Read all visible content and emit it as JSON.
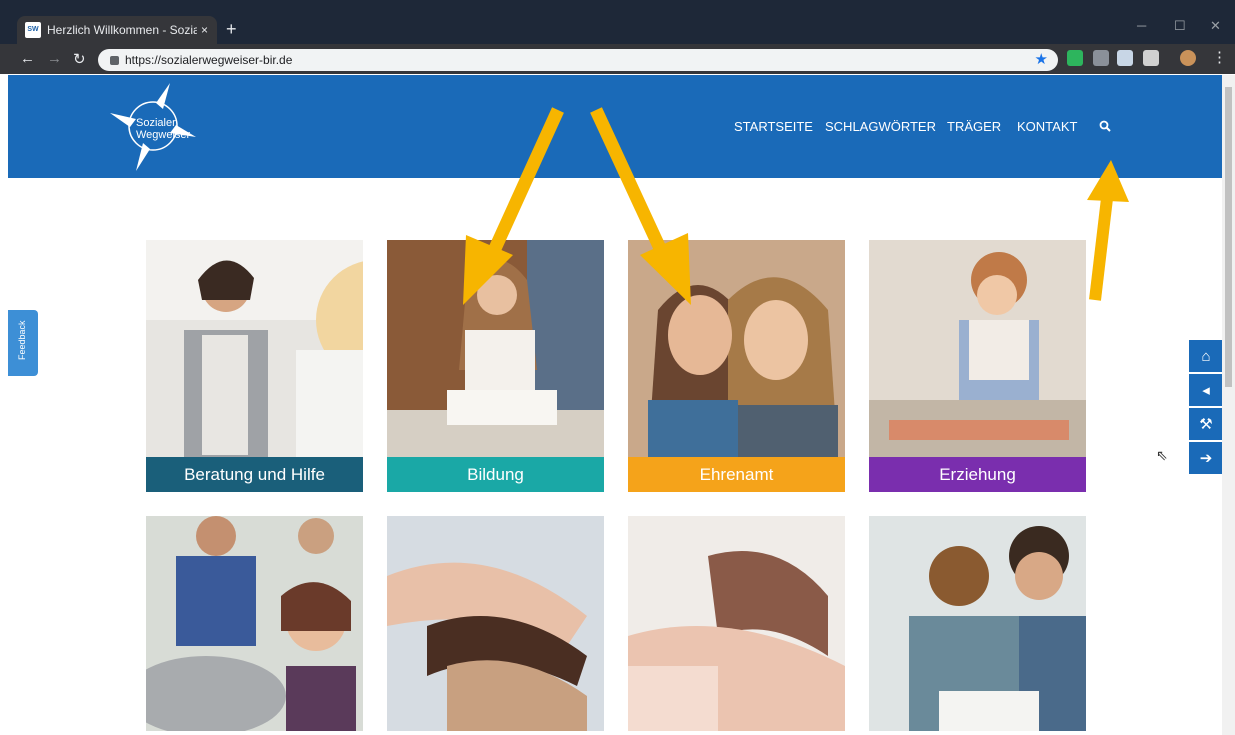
{
  "browser": {
    "tab_title": "Herzlich Willkommen - Sozialer W",
    "tab_favicon": "SW",
    "close_icon": "×",
    "new_tab_icon": "+",
    "url": "https://sozialerwegweiser-bir.de"
  },
  "site": {
    "logo_line1": "Sozialer",
    "logo_line2": "Wegweiser",
    "nav": [
      "STARTSEITE",
      "SCHLAGWÖRTER",
      "TRÄGER",
      "KONTAKT"
    ],
    "feedback": "Feedback"
  },
  "tiles": [
    {
      "label": "Beratung und Hilfe",
      "color": "#1a5f7a"
    },
    {
      "label": "Bildung",
      "color": "#1aa8a6"
    },
    {
      "label": "Ehrenamt",
      "color": "#f5a31a"
    },
    {
      "label": "Erziehung",
      "color": "#7a2eae"
    }
  ],
  "tiles_row2_colors": [
    "#c05cb0",
    "#4aa84a",
    "#d97a2a",
    "#9a3a8a"
  ],
  "accent_arrow_color": "#f7b500",
  "header_color": "#1a6ab8"
}
